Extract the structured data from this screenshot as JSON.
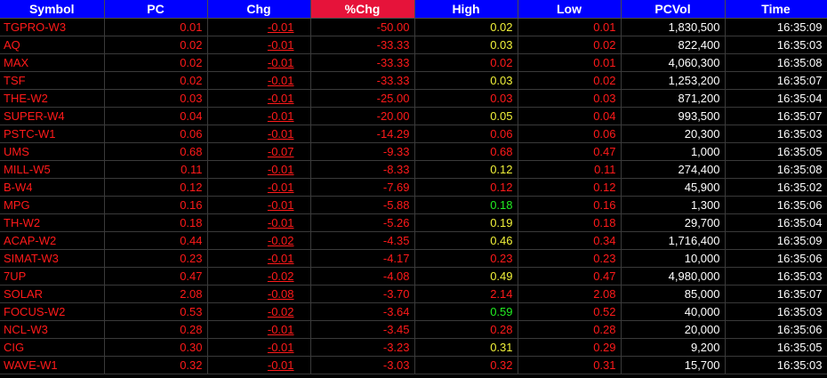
{
  "colors": {
    "header_bg": "#0000ff",
    "sorted_header_bg": "#e6133a",
    "down": "#ff1a1a",
    "up": "#22ee22",
    "mid": "#f2f23a",
    "neutral": "#ffffff"
  },
  "columns": [
    {
      "label": "Symbol",
      "key": "symbol",
      "sorted": false
    },
    {
      "label": "PC",
      "key": "pc",
      "sorted": false
    },
    {
      "label": "Chg",
      "key": "chg",
      "sorted": false
    },
    {
      "label": "%Chg",
      "key": "pchg",
      "sorted": true
    },
    {
      "label": "High",
      "key": "high",
      "sorted": false
    },
    {
      "label": "Low",
      "key": "low",
      "sorted": false
    },
    {
      "label": "PCVol",
      "key": "pcvol",
      "sorted": false
    },
    {
      "label": "Time",
      "key": "time",
      "sorted": false
    }
  ],
  "rows": [
    {
      "symbol": "TGPRO-W3",
      "pc": "0.01",
      "chg": "-0.01",
      "pchg": "-50.00",
      "high": "0.02",
      "high_color": "yellow",
      "low": "0.01",
      "pcvol": "1,830,500",
      "time": "16:35:09"
    },
    {
      "symbol": "AQ",
      "pc": "0.02",
      "chg": "-0.01",
      "pchg": "-33.33",
      "high": "0.03",
      "high_color": "yellow",
      "low": "0.02",
      "pcvol": "822,400",
      "time": "16:35:03"
    },
    {
      "symbol": "MAX",
      "pc": "0.02",
      "chg": "-0.01",
      "pchg": "-33.33",
      "high": "0.02",
      "high_color": "red",
      "low": "0.01",
      "pcvol": "4,060,300",
      "time": "16:35:08"
    },
    {
      "symbol": "TSF",
      "pc": "0.02",
      "chg": "-0.01",
      "pchg": "-33.33",
      "high": "0.03",
      "high_color": "yellow",
      "low": "0.02",
      "pcvol": "1,253,200",
      "time": "16:35:07"
    },
    {
      "symbol": "THE-W2",
      "pc": "0.03",
      "chg": "-0.01",
      "pchg": "-25.00",
      "high": "0.03",
      "high_color": "red",
      "low": "0.03",
      "pcvol": "871,200",
      "time": "16:35:04"
    },
    {
      "symbol": "SUPER-W4",
      "pc": "0.04",
      "chg": "-0.01",
      "pchg": "-20.00",
      "high": "0.05",
      "high_color": "yellow",
      "low": "0.04",
      "pcvol": "993,500",
      "time": "16:35:07"
    },
    {
      "symbol": "PSTC-W1",
      "pc": "0.06",
      "chg": "-0.01",
      "pchg": "-14.29",
      "high": "0.06",
      "high_color": "red",
      "low": "0.06",
      "pcvol": "20,300",
      "time": "16:35:03"
    },
    {
      "symbol": "UMS",
      "pc": "0.68",
      "chg": "-0.07",
      "pchg": "-9.33",
      "high": "0.68",
      "high_color": "red",
      "low": "0.47",
      "pcvol": "1,000",
      "time": "16:35:05"
    },
    {
      "symbol": "MILL-W5",
      "pc": "0.11",
      "chg": "-0.01",
      "pchg": "-8.33",
      "high": "0.12",
      "high_color": "yellow",
      "low": "0.11",
      "pcvol": "274,400",
      "time": "16:35:08"
    },
    {
      "symbol": "B-W4",
      "pc": "0.12",
      "chg": "-0.01",
      "pchg": "-7.69",
      "high": "0.12",
      "high_color": "red",
      "low": "0.12",
      "pcvol": "45,900",
      "time": "16:35:02"
    },
    {
      "symbol": "MPG",
      "pc": "0.16",
      "chg": "-0.01",
      "pchg": "-5.88",
      "high": "0.18",
      "high_color": "green",
      "low": "0.16",
      "pcvol": "1,300",
      "time": "16:35:06"
    },
    {
      "symbol": "TH-W2",
      "pc": "0.18",
      "chg": "-0.01",
      "pchg": "-5.26",
      "high": "0.19",
      "high_color": "yellow",
      "low": "0.18",
      "pcvol": "29,700",
      "time": "16:35:04"
    },
    {
      "symbol": "ACAP-W2",
      "pc": "0.44",
      "chg": "-0.02",
      "pchg": "-4.35",
      "high": "0.46",
      "high_color": "yellow",
      "low": "0.34",
      "pcvol": "1,716,400",
      "time": "16:35:09"
    },
    {
      "symbol": "SIMAT-W3",
      "pc": "0.23",
      "chg": "-0.01",
      "pchg": "-4.17",
      "high": "0.23",
      "high_color": "red",
      "low": "0.23",
      "pcvol": "10,000",
      "time": "16:35:06"
    },
    {
      "symbol": "7UP",
      "pc": "0.47",
      "chg": "-0.02",
      "pchg": "-4.08",
      "high": "0.49",
      "high_color": "yellow",
      "low": "0.47",
      "pcvol": "4,980,000",
      "time": "16:35:03"
    },
    {
      "symbol": "SOLAR",
      "pc": "2.08",
      "chg": "-0.08",
      "pchg": "-3.70",
      "high": "2.14",
      "high_color": "red",
      "low": "2.08",
      "pcvol": "85,000",
      "time": "16:35:07"
    },
    {
      "symbol": "FOCUS-W2",
      "pc": "0.53",
      "chg": "-0.02",
      "pchg": "-3.64",
      "high": "0.59",
      "high_color": "green",
      "low": "0.52",
      "pcvol": "40,000",
      "time": "16:35:03"
    },
    {
      "symbol": "NCL-W3",
      "pc": "0.28",
      "chg": "-0.01",
      "pchg": "-3.45",
      "high": "0.28",
      "high_color": "red",
      "low": "0.28",
      "pcvol": "20,000",
      "time": "16:35:06"
    },
    {
      "symbol": "CIG",
      "pc": "0.30",
      "chg": "-0.01",
      "pchg": "-3.23",
      "high": "0.31",
      "high_color": "yellow",
      "low": "0.29",
      "pcvol": "9,200",
      "time": "16:35:05"
    },
    {
      "symbol": "WAVE-W1",
      "pc": "0.32",
      "chg": "-0.01",
      "pchg": "-3.03",
      "high": "0.32",
      "high_color": "red",
      "low": "0.31",
      "pcvol": "15,700",
      "time": "16:35:03"
    }
  ]
}
